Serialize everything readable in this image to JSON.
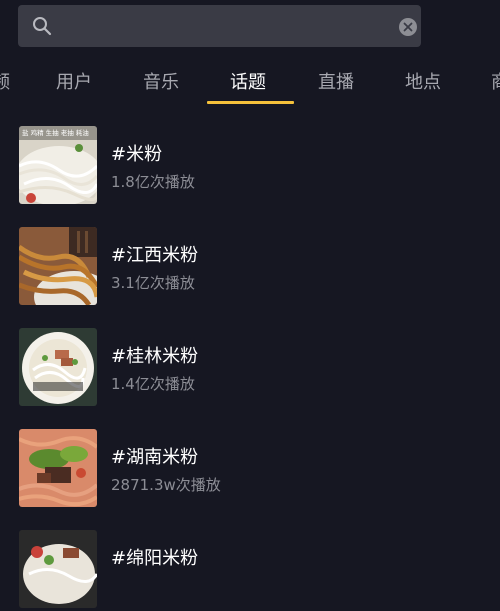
{
  "search": {
    "value": "",
    "placeholder": ""
  },
  "tabs": [
    {
      "label": "频"
    },
    {
      "label": "用户"
    },
    {
      "label": "音乐"
    },
    {
      "label": "话题"
    },
    {
      "label": "直播"
    },
    {
      "label": "地点"
    },
    {
      "label": "商"
    }
  ],
  "active_tab": "话题",
  "topics": [
    {
      "title": "#米粉",
      "count": "1.8亿次播放",
      "thumb_caption": "盐 鸡精 生抽 老抽 耗油"
    },
    {
      "title": "#江西米粉",
      "count": "3.1亿次播放"
    },
    {
      "title": "#桂林米粉",
      "count": "1.4亿次播放"
    },
    {
      "title": "#湖南米粉",
      "count": "2871.3w次播放"
    },
    {
      "title": "#绵阳米粉",
      "count": ""
    }
  ],
  "colors": {
    "accent": "#f5c13b",
    "background": "#161722",
    "search_bg": "#3a3b45"
  }
}
